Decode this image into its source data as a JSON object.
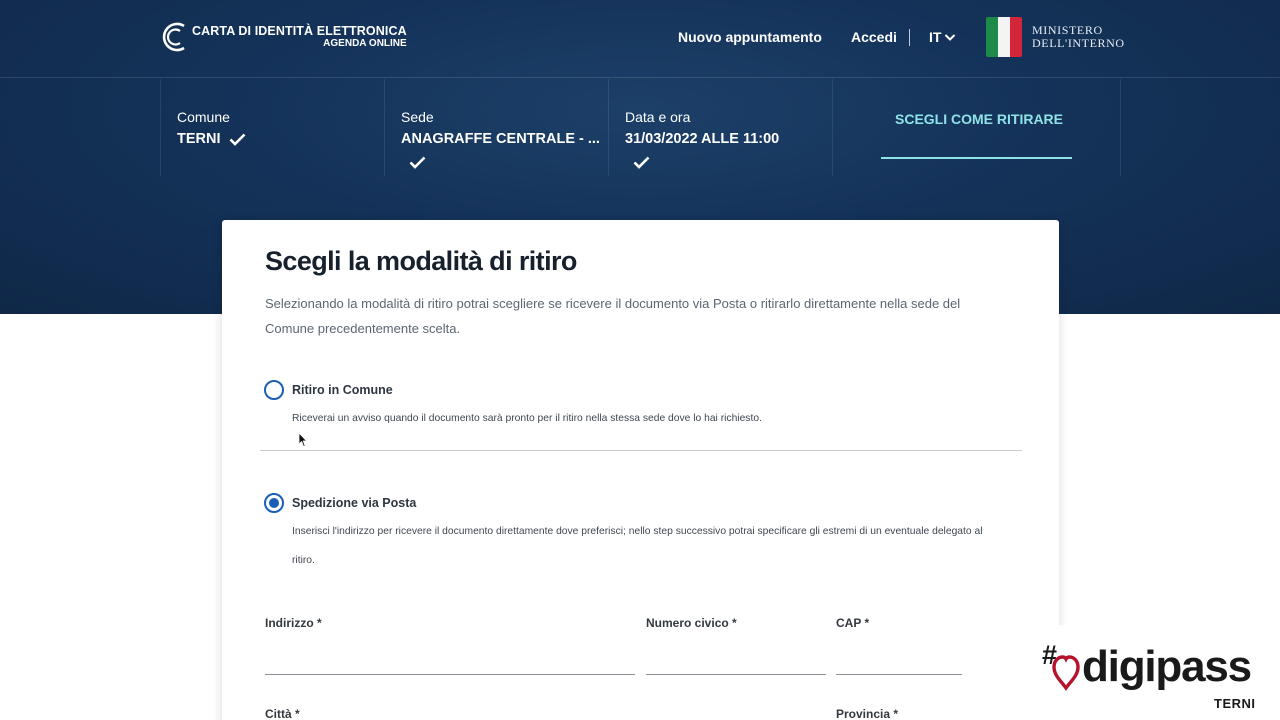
{
  "header": {
    "logo_title": "CARTA DI IDENTITÀ ELETTRONICA",
    "logo_subtitle": "AGENDA ONLINE",
    "nav_new_appointment": "Nuovo appuntamento",
    "nav_login": "Accedi",
    "language": "IT",
    "ministry_line1": "MINISTERO",
    "ministry_line2": "DELL'INTERNO",
    "flag_colors": [
      "#1e8a4a",
      "#f4f4f4",
      "#d3263a"
    ]
  },
  "steps": [
    {
      "label": "Comune",
      "value": "TERNI",
      "status": "completed"
    },
    {
      "label": "Sede",
      "value": "ANAGRAFFE CENTRALE - ...",
      "status": "completed"
    },
    {
      "label": "Data e ora",
      "value": "31/03/2022 ALLE 11:00",
      "status": "completed"
    },
    {
      "label": "SCEGLI COME RITIRARE",
      "status": "active"
    }
  ],
  "card": {
    "title": "Scegli la modalità di ritiro",
    "description": "Selezionando la modalità di ritiro potrai scegliere se ricevere il documento via Posta o ritirarlo direttamente nella sede del Comune precedentemente scelta.",
    "options": [
      {
        "label": "Ritiro in Comune",
        "description": "Riceverai un avviso quando il documento sarà pronto per il ritiro nella stessa sede dove lo hai richiesto.",
        "selected": false
      },
      {
        "label": "Spedizione via Posta",
        "description_line1": "Inserisci l'indirizzo per ricevere il documento direttamente dove preferisci; nello step successivo potrai specificare gli estremi di un eventuale delegato al",
        "description_line2": "ritiro.",
        "selected": true
      }
    ],
    "fields": {
      "address_label": "Indirizzo *",
      "address_value": "",
      "civic_label": "Numero civico *",
      "civic_value": "",
      "cap_label": "CAP *",
      "cap_value": "",
      "city_label": "Città *",
      "province_label": "Provincia *"
    }
  },
  "watermark": {
    "hash": "#",
    "word": "digipass",
    "city": "TERNI",
    "accent_color": "#b5122b"
  },
  "colors": {
    "header_bg": "#143259",
    "active_step": "#8fe3e6",
    "radio": "#1a5fb4"
  }
}
